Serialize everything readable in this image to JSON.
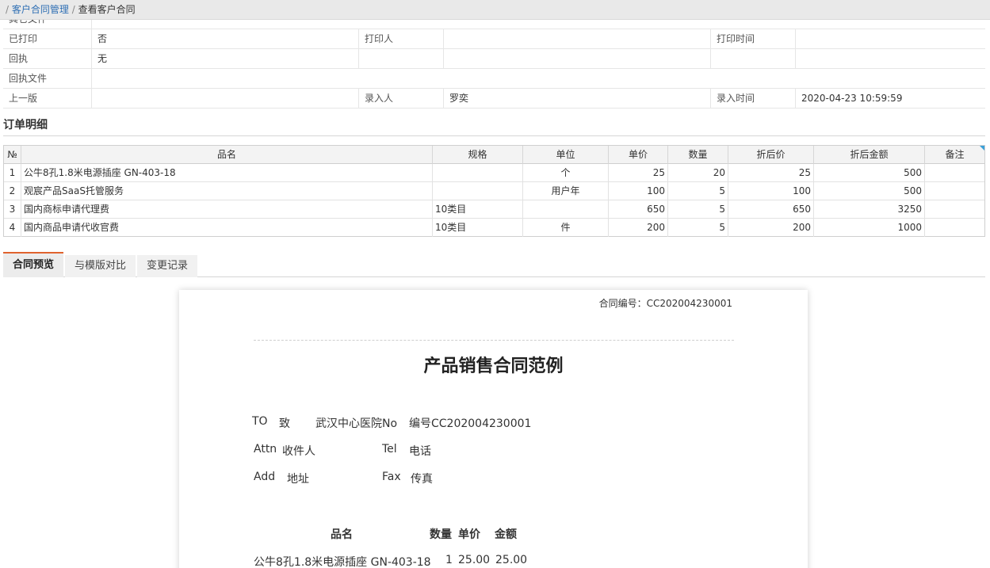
{
  "breadcrumb": {
    "sep1": "/",
    "link": "客户合同管理",
    "sep2": "/",
    "current": "查看客户合同"
  },
  "info": {
    "partial_label": "其它文件",
    "rows": [
      {
        "l1": "已打印",
        "v1": "否",
        "l2": "打印人",
        "v2": "",
        "l3": "打印时间",
        "v3": ""
      },
      {
        "l1": "回执",
        "v1": "无",
        "l2": "",
        "v2": "",
        "l3": "",
        "v3": ""
      },
      {
        "l1": "回执文件",
        "v1": "",
        "l2": "",
        "v2": "",
        "l3": "",
        "v3": ""
      },
      {
        "l1": "上一版",
        "v1": "",
        "l2": "录入人",
        "v2": "罗奕",
        "l3": "录入时间",
        "v3": "2020-04-23 10:59:59"
      }
    ]
  },
  "order": {
    "title": "订单明细",
    "headers": [
      "№",
      "品名",
      "规格",
      "单位",
      "单价",
      "数量",
      "折后价",
      "折后金额",
      "备注"
    ],
    "rows": [
      [
        "1",
        "公牛8孔1.8米电源插座 GN-403-18",
        "",
        "个",
        "25",
        "20",
        "25",
        "500",
        ""
      ],
      [
        "2",
        "观宸产品SaaS托管服务",
        "",
        "用户年",
        "100",
        "5",
        "100",
        "500",
        ""
      ],
      [
        "3",
        "国内商标申请代理费",
        "10类目",
        "",
        "650",
        "5",
        "650",
        "3250",
        ""
      ],
      [
        "4",
        "国内商品申请代收官费",
        "10类目",
        "件",
        "200",
        "5",
        "200",
        "1000",
        ""
      ]
    ]
  },
  "tabs": [
    "合同预览",
    "与模版对比",
    "变更记录"
  ],
  "contract": {
    "code_label": "合同编号：CC202004230001",
    "title": "产品销售合同范例",
    "to": "TO",
    "to_cn": "致",
    "to_value": "武汉中心医院No",
    "no_value": "编号CC202004230001",
    "attn": "Attn",
    "attn_cn": "收件人",
    "tel": "Tel",
    "tel_cn": "电话",
    "add": "Add",
    "add_cn": "地址",
    "fax": "Fax",
    "fax_cn": "传真",
    "items_header": {
      "name": "品名",
      "qty": "数量",
      "price": "单价",
      "amount": "金额"
    },
    "items": [
      {
        "name": "公牛8孔1.8米电源插座  GN-403-18",
        "qty": "1",
        "price": "25.00",
        "amount": "25.00"
      }
    ]
  },
  "colors": {
    "link": "#2f6fb4",
    "tab_accent": "#e0632e",
    "grid_corner": "#3aa0d8"
  }
}
